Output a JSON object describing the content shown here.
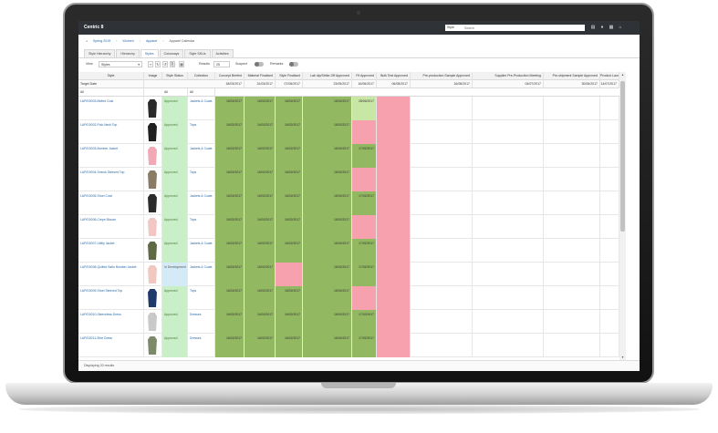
{
  "app": {
    "brand": "Centric 8"
  },
  "search": {
    "scope": "Style",
    "placeholder": "Search"
  },
  "breadcrumb": {
    "items": [
      "Spring 2019",
      "Women",
      "Apparel"
    ],
    "current": "Apparel Calendar"
  },
  "tabs": [
    "Style Hierarchy",
    "Hierarchy",
    "Styles",
    "Colorways",
    "Style SKUs",
    "Activities"
  ],
  "active_tab": 2,
  "toolbar": {
    "view_label": "View",
    "view_value": "Styles",
    "results_label": "Results",
    "results_value": "25",
    "suspect_label": "Suspect",
    "remarks_label": "Remarks"
  },
  "columns": [
    "Style",
    "Image",
    "Style Status",
    "Collection",
    "Concept Briefed",
    "Material Finalised",
    "Style Finalised",
    "Lab dip/Strike-Off Approved",
    "Fit Approved",
    "Bulk Test Approved",
    "Pre-production Sample Approved",
    "Supplier Pre-Production Meeting",
    "Pre-shipment Sample Approved",
    "Product Launch Date"
  ],
  "target_row": {
    "label": "Target Date",
    "dates": [
      "18/03/2017",
      "31/03/2017",
      "07/06/2017",
      "23/05/2017",
      "16/06/2017",
      "06/08/2017",
      "16/08/2017",
      "04/07/2017",
      "30/06/2017",
      "14/07/2017"
    ]
  },
  "filter_row": {
    "first": "All",
    "status": "All",
    "collection": "All"
  },
  "rows": [
    {
      "name": "LAP/D0003-Belted Coat",
      "status": "Approved",
      "collection": "Jackets & Coats",
      "cells": [
        "16/02/2017",
        "16/02/2017",
        "16/02/2017",
        "16/02/2017",
        "28/06/2017"
      ],
      "fills": [
        "g",
        "g",
        "g",
        "g",
        "lg",
        "p"
      ],
      "sc": "sg",
      "img": "#2a2a2a"
    },
    {
      "name": "LAP/D0002-Polo Neck Top",
      "status": "Approved",
      "collection": "Tops",
      "cells": [
        "16/02/2017",
        "16/02/2017",
        "16/02/2017",
        "16/02/2017",
        ""
      ],
      "fills": [
        "g",
        "g",
        "g",
        "g",
        "p",
        "p"
      ],
      "sc": "sg",
      "img": "#1f1f1f"
    },
    {
      "name": "LAP/D0003-Bomber Jacket",
      "status": "Approved",
      "collection": "Jackets & Coats",
      "cells": [
        "16/02/2017",
        "16/02/2017",
        "16/02/2017",
        "16/02/2017",
        "17/02/2017"
      ],
      "fills": [
        "g",
        "g",
        "g",
        "g",
        "g",
        "p"
      ],
      "sc": "sg",
      "img": "#f2a8b5"
    },
    {
      "name": "LAP/D0004-Smock Sleeved Top",
      "status": "Approved",
      "collection": "Tops",
      "cells": [
        "16/02/2017",
        "16/02/2017",
        "16/02/2017",
        "16/02/2017",
        ""
      ],
      "fills": [
        "g",
        "g",
        "g",
        "g",
        "p",
        "p"
      ],
      "sc": "sg",
      "img": "#8a7b65"
    },
    {
      "name": "LAP/D0005-Short Coat",
      "status": "Approved",
      "collection": "Jackets & Coats",
      "cells": [
        "16/02/2017",
        "16/02/2017",
        "16/02/2017",
        "16/02/2017",
        "17/02/2017"
      ],
      "fills": [
        "g",
        "g",
        "g",
        "g",
        "g",
        "p"
      ],
      "sc": "sg",
      "img": "#2b2b2b"
    },
    {
      "name": "LAP/D0006-Crepe Blouse",
      "status": "Approved",
      "collection": "Tops",
      "cells": [
        "16/02/2017",
        "16/02/2017",
        "16/02/2017",
        "16/02/2017",
        ""
      ],
      "fills": [
        "g",
        "g",
        "g",
        "g",
        "p",
        "p"
      ],
      "sc": "sg",
      "img": "#f3c6c6"
    },
    {
      "name": "LAP/D0007-Utility Jacket",
      "status": "Approved",
      "collection": "Jackets & Coats",
      "cells": [
        "16/02/2017",
        "16/02/2017",
        "16/02/2017",
        "16/02/2017",
        "17/02/2017"
      ],
      "fills": [
        "g",
        "g",
        "g",
        "g",
        "g",
        "p"
      ],
      "sc": "sg",
      "img": "#5f6a45"
    },
    {
      "name": "LAP/D0008-Quilted Satin Bomber Jacket",
      "status": "In Development",
      "collection": "Jackets & Coats",
      "cells": [
        "16/02/2017",
        "16/02/2017",
        "",
        "16/02/2017",
        "17/02/2017"
      ],
      "fills": [
        "g",
        "g",
        "p",
        "g",
        "g",
        "p"
      ],
      "sc": "sb",
      "img": "#f0c8c0"
    },
    {
      "name": "LAP/D0009-Short Sleeved Top",
      "status": "Approved",
      "collection": "Tops",
      "cells": [
        "16/02/2017",
        "16/02/2017",
        "16/02/2017",
        "16/02/2017",
        ""
      ],
      "fills": [
        "g",
        "g",
        "g",
        "g",
        "p",
        "p"
      ],
      "sc": "sg",
      "img": "#1e3a6a"
    },
    {
      "name": "LAP/D0010-Sleeveless Dress",
      "status": "Approved",
      "collection": "Dresses",
      "cells": [
        "16/02/2017",
        "16/02/2017",
        "16/02/2017",
        "16/02/2017",
        "17/02/2017"
      ],
      "fills": [
        "g",
        "g",
        "g",
        "g",
        "g",
        "p"
      ],
      "sc": "sg",
      "img": "#c9c9c9"
    },
    {
      "name": "LAP/D0011-Shirt Dress",
      "status": "Approved",
      "collection": "Dresses",
      "cells": [
        "16/02/2017",
        "16/02/2017",
        "16/02/2017",
        "16/02/2017",
        "17/02/2017"
      ],
      "fills": [
        "g",
        "g",
        "g",
        "g",
        "g",
        "p"
      ],
      "sc": "sg",
      "img": "#7c8a6a"
    }
  ],
  "footer": {
    "text": "Displaying 20 results"
  }
}
